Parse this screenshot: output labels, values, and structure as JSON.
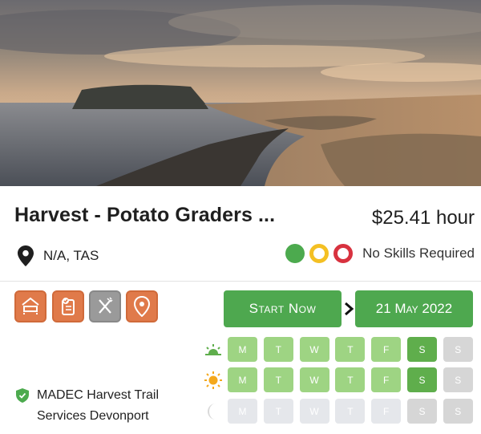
{
  "listing": {
    "title": "Harvest - Potato Graders ...",
    "price": "$25.41 hour",
    "location": "N/A, TAS",
    "skills_label": "No Skills Required",
    "company_line1": "MADEC Harvest Trail",
    "company_line2": "Services Devonport"
  },
  "amenities": [
    {
      "icon": "bed-icon",
      "active": true
    },
    {
      "icon": "document-icon",
      "active": true
    },
    {
      "icon": "fork-knife-icon",
      "active": false
    },
    {
      "icon": "map-pin-icon",
      "active": true
    }
  ],
  "actions": {
    "start_label": "Start Now",
    "date_label": "21 May 2022"
  },
  "schedule": {
    "days": [
      "M",
      "T",
      "W",
      "T",
      "F",
      "S",
      "S"
    ],
    "rows": [
      {
        "icon": "sunrise-icon",
        "states": [
          "on",
          "on",
          "on",
          "on",
          "on",
          "strong",
          "off"
        ]
      },
      {
        "icon": "sun-icon",
        "states": [
          "on",
          "on",
          "on",
          "on",
          "on",
          "strong",
          "off"
        ]
      },
      {
        "icon": "moon-icon",
        "states": [
          "faint",
          "faint",
          "faint",
          "faint",
          "faint",
          "off",
          "off"
        ]
      }
    ]
  },
  "colors": {
    "accent_green": "#4ea84f",
    "amenity_orange": "#e07a4a",
    "skill_green": "#4caa4e",
    "skill_yellow": "#f4c023",
    "skill_red": "#d8323f"
  }
}
